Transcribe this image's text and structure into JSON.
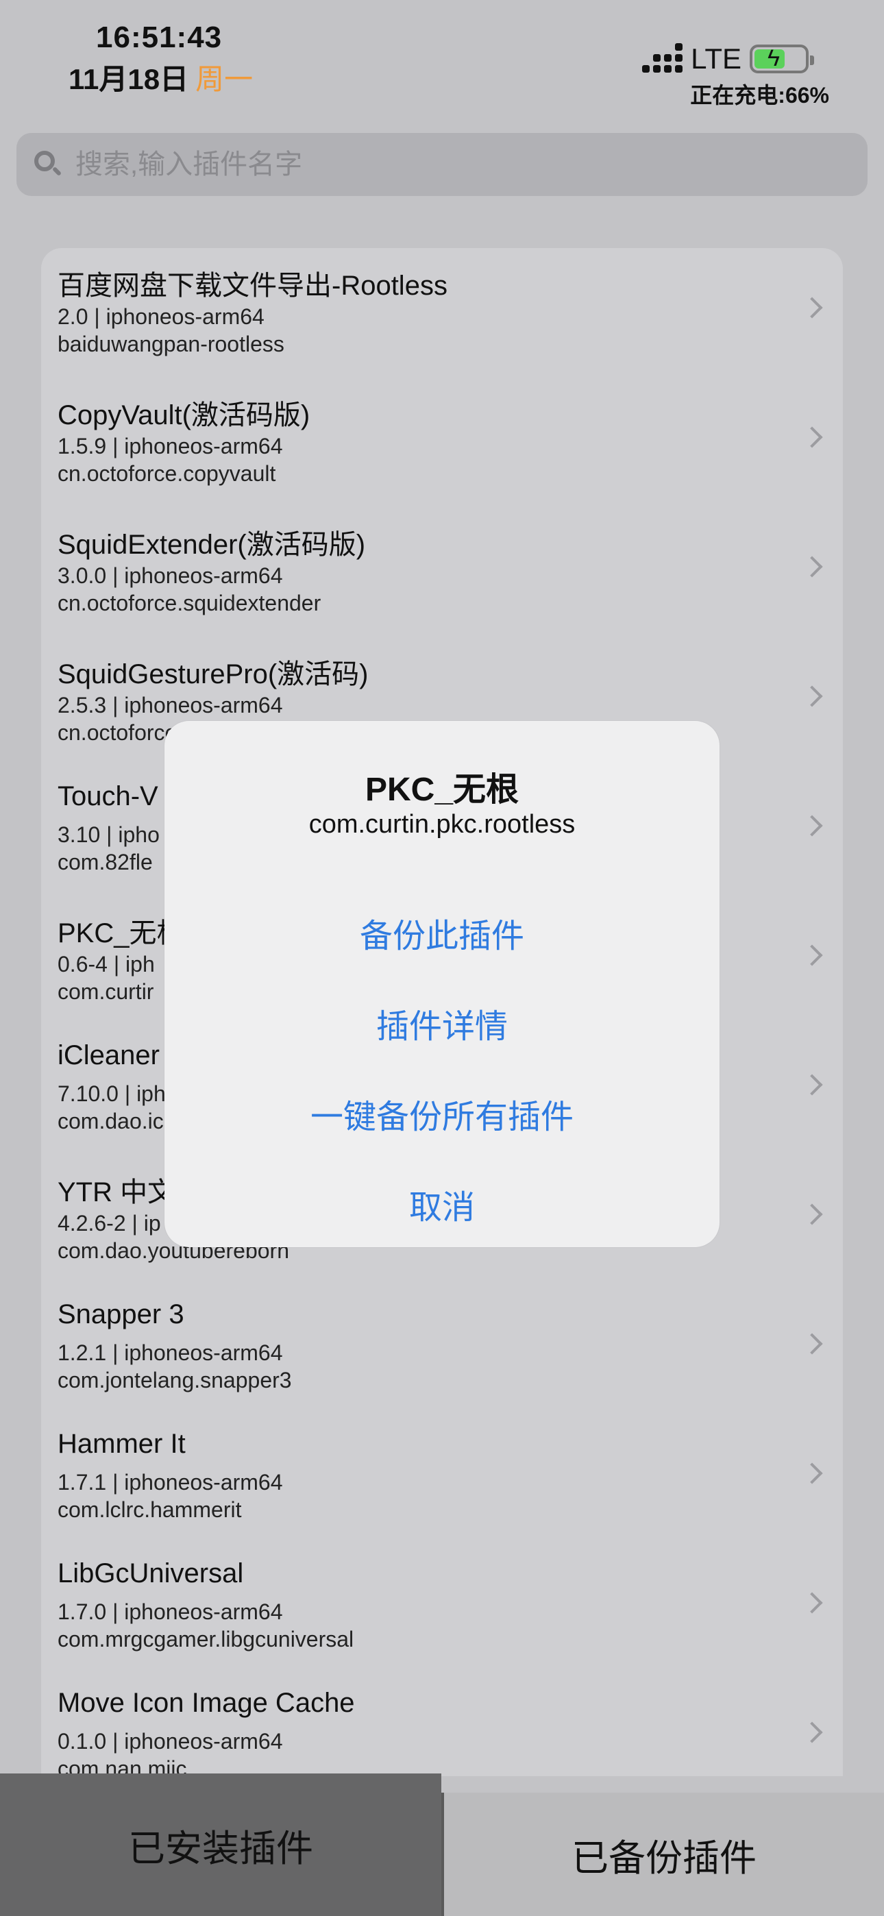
{
  "status": {
    "time": "16:51:43",
    "date": "11月18日",
    "weekday": "周一",
    "network": "LTE",
    "charging_text": "正在充电:66%",
    "battery_percent": 66,
    "battery_color": "#5bd15b"
  },
  "search": {
    "placeholder": "搜索,输入插件名字"
  },
  "plugins": [
    {
      "title": "百度网盘下载文件导出-Rootless",
      "meta": "2.0 | iphoneos-arm64",
      "id": "baiduwangpan-rootless"
    },
    {
      "title": "CopyVault(激活码版)",
      "meta": "1.5.9 | iphoneos-arm64",
      "id": "cn.octoforce.copyvault"
    },
    {
      "title": "SquidExtender(激活码版)",
      "meta": "3.0.0 | iphoneos-arm64",
      "id": "cn.octoforce.squidextender"
    },
    {
      "title": "SquidGesturePro(激活码)",
      "meta": "2.5.3 | iphoneos-arm64",
      "id": "cn.octoforce"
    },
    {
      "title": "Touch-V",
      "meta": "3.10 | ipho",
      "id": "com.82fle"
    },
    {
      "title": "PKC_无根",
      "meta": "0.6-4 | iph",
      "id": "com.curtir"
    },
    {
      "title": "iCleaner",
      "meta": "7.10.0 | iph",
      "id": "com.dao.ic"
    },
    {
      "title": "YTR 中文",
      "meta": "4.2.6-2 | ip",
      "id": "com.dao.youtubereborn"
    },
    {
      "title": "Snapper 3",
      "meta": "1.2.1 | iphoneos-arm64",
      "id": "com.jontelang.snapper3"
    },
    {
      "title": "Hammer It",
      "meta": "1.7.1 | iphoneos-arm64",
      "id": "com.lclrc.hammerit"
    },
    {
      "title": "LibGcUniversal",
      "meta": "1.7.0 | iphoneos-arm64",
      "id": "com.mrgcgamer.libgcuniversal"
    },
    {
      "title": "Move Icon Image Cache",
      "meta": "0.1.0 | iphoneos-arm64",
      "id": "com.nan.miic"
    }
  ],
  "dialog": {
    "title": "PKC_无根",
    "subtitle": "com.curtin.pkc.rootless",
    "backup_label": "备份此插件",
    "details_label": "插件详情",
    "backup_all_label": "一键备份所有插件",
    "cancel_label": "取消",
    "accent_color": "#2f7be0"
  },
  "tabs": {
    "installed_label": "已安装插件",
    "backup_label": "已备份插件"
  }
}
